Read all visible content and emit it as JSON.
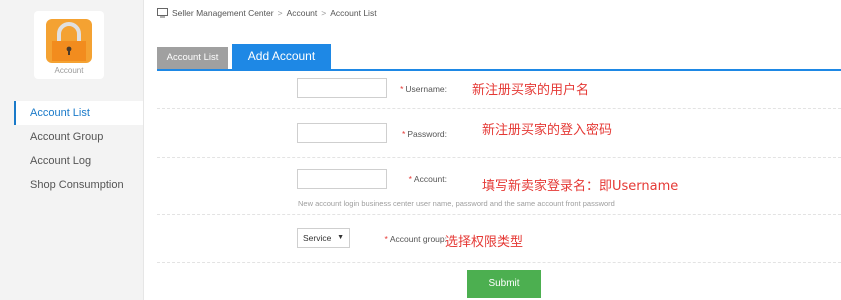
{
  "sidebar": {
    "app_label": "Account",
    "app_icon": "lock-icon",
    "items": [
      {
        "label": "Account List",
        "active": true
      },
      {
        "label": "Account Group",
        "active": false
      },
      {
        "label": "Account Log",
        "active": false
      },
      {
        "label": "Shop Consumption",
        "active": false
      }
    ]
  },
  "breadcrumb": {
    "icon": "monitor-icon",
    "items": [
      "Seller Management Center",
      "Account",
      "Account List"
    ],
    "separator": ">"
  },
  "tabs": [
    {
      "label": "Account List",
      "active": false
    },
    {
      "label": "Add Account",
      "active": true
    }
  ],
  "form": {
    "required_mark": "*",
    "username": {
      "label": "Username:",
      "value": "",
      "annotation": "新注册买家的用户名"
    },
    "password": {
      "label": "Password:",
      "value": "",
      "annotation": "新注册买家的登入密码"
    },
    "account": {
      "label": "Account:",
      "value": "",
      "hint": "New account login business center user name, password and the same account front password",
      "annotation": "填写新卖家登录名：即Username"
    },
    "account_group": {
      "label": "Account group:",
      "selected": "Service",
      "annotation": "选择权限类型"
    },
    "submit_label": "Submit"
  },
  "colors": {
    "accent": "#1e88e5",
    "submit": "#4caf50",
    "required": "#e53935",
    "annotation": "#e53935"
  }
}
